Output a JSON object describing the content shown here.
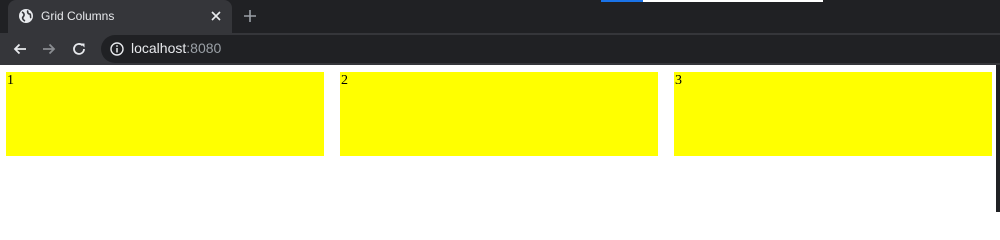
{
  "browser": {
    "tab": {
      "title": "Grid Columns",
      "favicon_icon": "globe-icon",
      "close_icon": "close-icon"
    },
    "new_tab_icon": "plus-icon",
    "toolbar": {
      "back_icon": "back-arrow-icon",
      "forward_icon": "forward-arrow-icon",
      "reload_icon": "reload-icon",
      "info_icon": "info-icon",
      "url_host": "localhost",
      "url_port": ":8080"
    },
    "colors": {
      "tabstrip": "#202124",
      "active_tab": "#35363a",
      "omnibox": "#202124"
    }
  },
  "page": {
    "cells": [
      "1",
      "2",
      "3"
    ],
    "colors": {
      "cell_background": "#ffff00",
      "page_background": "#ffffff"
    }
  }
}
